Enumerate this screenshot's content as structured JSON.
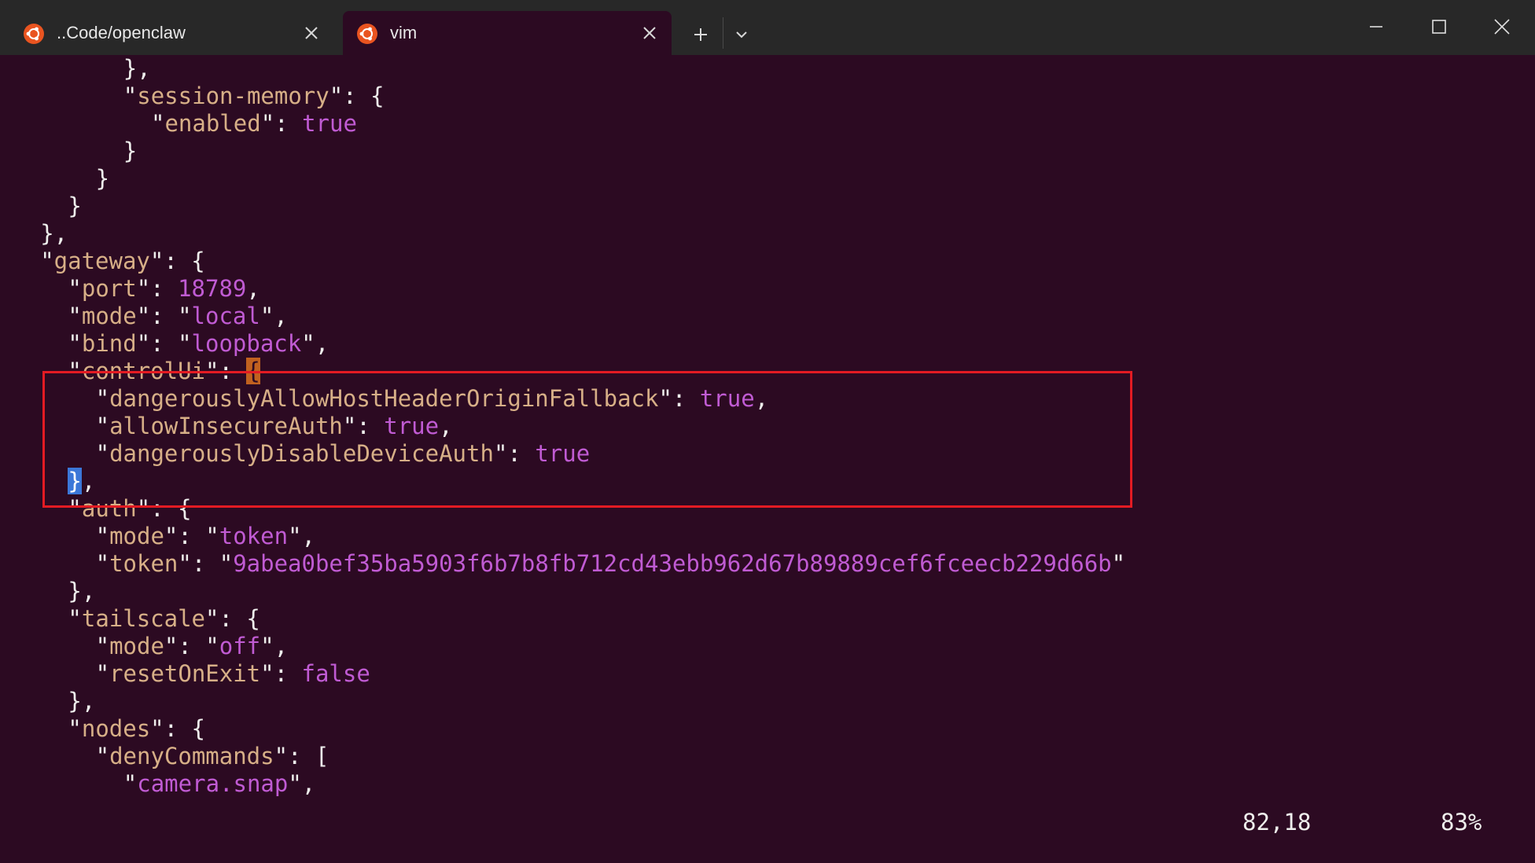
{
  "window": {
    "tabs": [
      {
        "label": "..Code/openclaw",
        "icon": "ubuntu-icon",
        "active": false
      },
      {
        "label": "vim",
        "icon": "ubuntu-icon",
        "active": true
      }
    ],
    "new_tab_icon": "plus-icon",
    "dropdown_icon": "chevron-down-icon",
    "controls": [
      "minimize-icon",
      "maximize-icon",
      "close-icon"
    ]
  },
  "colors": {
    "background": "#2c0a22",
    "titlebar": "#282828",
    "key": "#d7af87",
    "value": "#c05bd3",
    "punct": "#eeeeec",
    "highlight_box": "#e31b23",
    "cursor_open": "#c0611f",
    "cursor_close": "#3b77d8"
  },
  "editor": {
    "lines": [
      {
        "indent": 8,
        "segs": [
          [
            "p",
            "},"
          ]
        ]
      },
      {
        "indent": 8,
        "segs": [
          [
            "p",
            "\""
          ],
          [
            "k",
            "session-memory"
          ],
          [
            "p",
            "\": {"
          ]
        ]
      },
      {
        "indent": 10,
        "segs": [
          [
            "p",
            "\""
          ],
          [
            "k",
            "enabled"
          ],
          [
            "p",
            "\": "
          ],
          [
            "n",
            "true"
          ]
        ]
      },
      {
        "indent": 8,
        "segs": [
          [
            "p",
            "}"
          ]
        ]
      },
      {
        "indent": 6,
        "segs": [
          [
            "p",
            "}"
          ]
        ]
      },
      {
        "indent": 4,
        "segs": [
          [
            "p",
            "}"
          ]
        ]
      },
      {
        "indent": 2,
        "segs": [
          [
            "p",
            "},"
          ]
        ]
      },
      {
        "indent": 2,
        "segs": [
          [
            "p",
            "\""
          ],
          [
            "k",
            "gateway"
          ],
          [
            "p",
            "\": {"
          ]
        ]
      },
      {
        "indent": 4,
        "segs": [
          [
            "p",
            "\""
          ],
          [
            "k",
            "port"
          ],
          [
            "p",
            "\": "
          ],
          [
            "n",
            "18789"
          ],
          [
            "p",
            ","
          ]
        ]
      },
      {
        "indent": 4,
        "segs": [
          [
            "p",
            "\""
          ],
          [
            "k",
            "mode"
          ],
          [
            "p",
            "\": \""
          ],
          [
            "s",
            "local"
          ],
          [
            "p",
            "\","
          ]
        ]
      },
      {
        "indent": 4,
        "segs": [
          [
            "p",
            "\""
          ],
          [
            "k",
            "bind"
          ],
          [
            "p",
            "\": \""
          ],
          [
            "s",
            "loopback"
          ],
          [
            "p",
            "\","
          ]
        ]
      },
      {
        "indent": 4,
        "segs": [
          [
            "p",
            "\""
          ],
          [
            "k",
            "controlUi"
          ],
          [
            "p",
            "\": "
          ],
          [
            "cur-open",
            "{"
          ]
        ]
      },
      {
        "indent": 6,
        "segs": [
          [
            "p",
            "\""
          ],
          [
            "k",
            "dangerouslyAllowHostHeaderOriginFallback"
          ],
          [
            "p",
            "\": "
          ],
          [
            "n",
            "true"
          ],
          [
            "p",
            ","
          ]
        ]
      },
      {
        "indent": 6,
        "segs": [
          [
            "p",
            "\""
          ],
          [
            "k",
            "allowInsecureAuth"
          ],
          [
            "p",
            "\": "
          ],
          [
            "n",
            "true"
          ],
          [
            "p",
            ","
          ]
        ]
      },
      {
        "indent": 6,
        "segs": [
          [
            "p",
            "\""
          ],
          [
            "k",
            "dangerouslyDisableDeviceAuth"
          ],
          [
            "p",
            "\": "
          ],
          [
            "n",
            "true"
          ]
        ]
      },
      {
        "indent": 4,
        "segs": [
          [
            "cur-close",
            "}"
          ],
          [
            "p",
            ","
          ]
        ]
      },
      {
        "indent": 4,
        "segs": [
          [
            "p",
            "\""
          ],
          [
            "k",
            "auth"
          ],
          [
            "p",
            "\": {"
          ]
        ]
      },
      {
        "indent": 6,
        "segs": [
          [
            "p",
            "\""
          ],
          [
            "k",
            "mode"
          ],
          [
            "p",
            "\": \""
          ],
          [
            "s",
            "token"
          ],
          [
            "p",
            "\","
          ]
        ]
      },
      {
        "indent": 6,
        "segs": [
          [
            "p",
            "\""
          ],
          [
            "k",
            "token"
          ],
          [
            "p",
            "\": \""
          ],
          [
            "s",
            "9abea0bef35ba5903f6b7b8fb712cd43ebb962d67b89889cef6fceecb229d66b"
          ],
          [
            "p",
            "\""
          ]
        ]
      },
      {
        "indent": 4,
        "segs": [
          [
            "p",
            "},"
          ]
        ]
      },
      {
        "indent": 4,
        "segs": [
          [
            "p",
            "\""
          ],
          [
            "k",
            "tailscale"
          ],
          [
            "p",
            "\": {"
          ]
        ]
      },
      {
        "indent": 6,
        "segs": [
          [
            "p",
            "\""
          ],
          [
            "k",
            "mode"
          ],
          [
            "p",
            "\": \""
          ],
          [
            "s",
            "off"
          ],
          [
            "p",
            "\","
          ]
        ]
      },
      {
        "indent": 6,
        "segs": [
          [
            "p",
            "\""
          ],
          [
            "k",
            "resetOnExit"
          ],
          [
            "p",
            "\": "
          ],
          [
            "n",
            "false"
          ]
        ]
      },
      {
        "indent": 4,
        "segs": [
          [
            "p",
            "},"
          ]
        ]
      },
      {
        "indent": 4,
        "segs": [
          [
            "p",
            "\""
          ],
          [
            "k",
            "nodes"
          ],
          [
            "p",
            "\": {"
          ]
        ]
      },
      {
        "indent": 6,
        "segs": [
          [
            "p",
            "\""
          ],
          [
            "k",
            "denyCommands"
          ],
          [
            "p",
            "\": ["
          ]
        ]
      },
      {
        "indent": 8,
        "segs": [
          [
            "p",
            "\""
          ],
          [
            "s",
            "camera.snap"
          ],
          [
            "p",
            "\","
          ]
        ]
      }
    ]
  },
  "statusline": {
    "position": "82,18",
    "percent": "83%"
  }
}
